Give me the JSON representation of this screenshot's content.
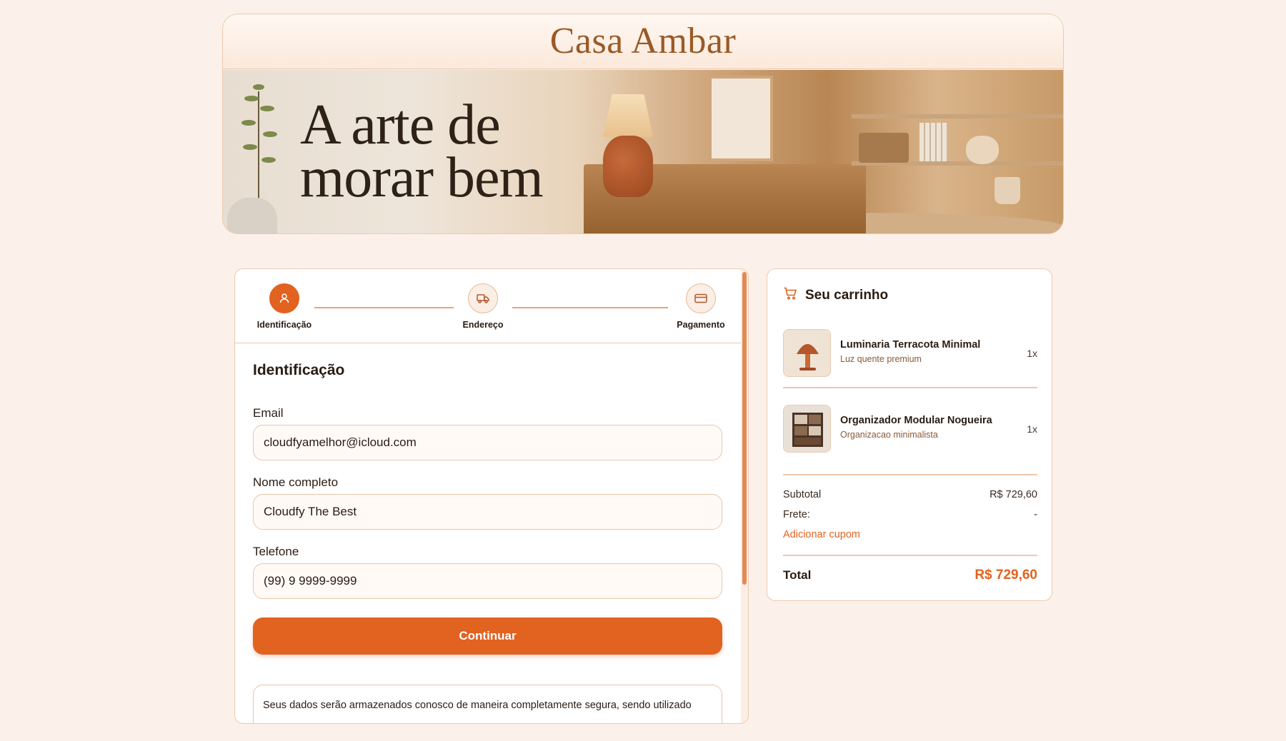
{
  "brand": {
    "name": "Casa Ambar"
  },
  "hero": {
    "line1": "A arte de",
    "line2": "morar bem"
  },
  "steps": [
    {
      "label": "Identificação",
      "icon": "user-icon",
      "active": true
    },
    {
      "label": "Endereço",
      "icon": "truck-icon",
      "active": false
    },
    {
      "label": "Pagamento",
      "icon": "credit-card-icon",
      "active": false
    }
  ],
  "form": {
    "title": "Identificação",
    "email_label": "Email",
    "email_value": "cloudfyamelhor@icloud.com",
    "name_label": "Nome completo",
    "name_value": "Cloudfy The Best",
    "phone_label": "Telefone",
    "phone_value": "(99) 9 9999-9999",
    "continue_label": "Continuar",
    "privacy_text": "Seus dados serão armazenados conosco de maneira completamente segura, sendo utilizado"
  },
  "cart": {
    "title": "Seu carrinho",
    "items": [
      {
        "name": "Luminaria Terracota Minimal",
        "subtitle": "Luz quente premium",
        "qty": "1x"
      },
      {
        "name": "Organizador Modular Nogueira",
        "subtitle": "Organizacao minimalista",
        "qty": "1x"
      }
    ],
    "subtotal_label": "Subtotal",
    "subtotal_value": "R$ 729,60",
    "shipping_label": "Frete:",
    "shipping_value": "-",
    "coupon_label": "Adicionar cupom",
    "total_label": "Total",
    "total_value": "R$ 729,60"
  },
  "colors": {
    "accent": "#e2621f",
    "brand": "#9a5a26",
    "border": "#ecc9ad",
    "background": "#fcf1ea"
  }
}
